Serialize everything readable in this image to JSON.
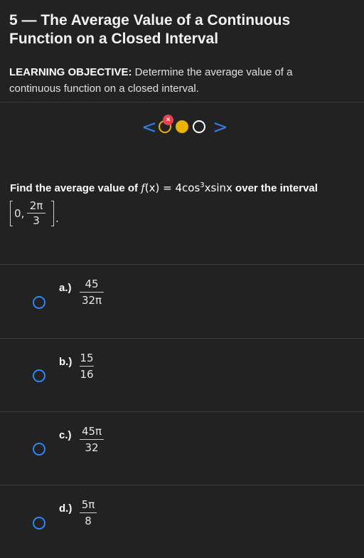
{
  "header": {
    "title": "5 — The Average Value of a Continuous Function on a Closed Interval"
  },
  "objective": {
    "label": "LEARNING OBJECTIVE:",
    "text": " Determine the average value of a continuous function on a closed interval."
  },
  "stepper": {
    "prev_glyph": "<",
    "next_glyph": ">",
    "badge": "×",
    "colors": {
      "accent": "#e9b400",
      "nav": "#2f7fe8",
      "error": "#e8424f"
    }
  },
  "question": {
    "prefix": "Find the average value of ",
    "func_name": "f",
    "func_arg": "(x)",
    "equals": " = 4cos",
    "exp": "3",
    "func_rest": "xsinx",
    "suffix": " over the interval",
    "interval": {
      "left": "0,",
      "num": "2π",
      "den": "3",
      "end": "."
    }
  },
  "options": [
    {
      "label": "a.)",
      "num": "45",
      "den": "32π"
    },
    {
      "label": "b.)",
      "num": "15",
      "den": "16"
    },
    {
      "label": "c.)",
      "num": "45π",
      "den": "32"
    },
    {
      "label": "d.)",
      "num": "5π",
      "den": "8"
    }
  ]
}
